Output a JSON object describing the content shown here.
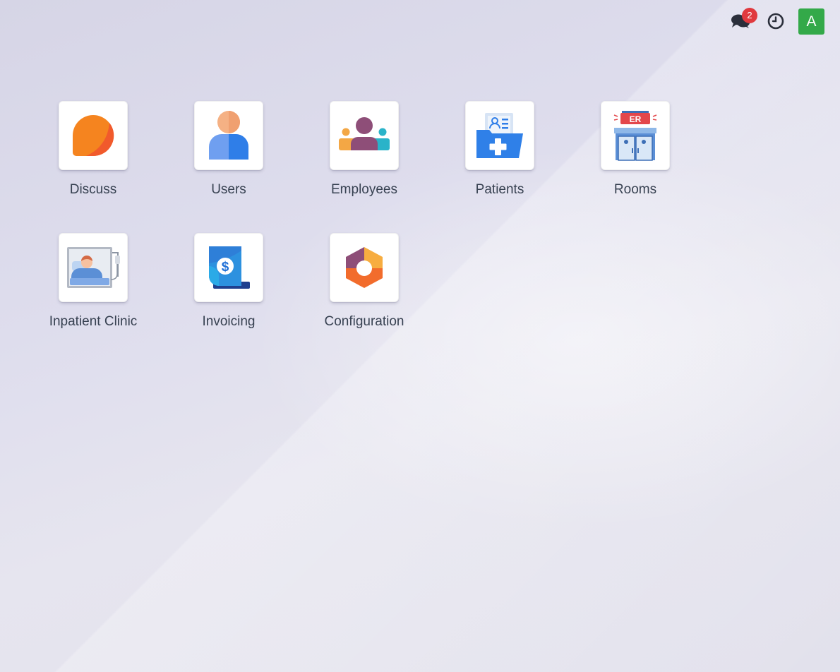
{
  "systray": {
    "messages_count": "2",
    "user_initial": "A"
  },
  "apps": [
    {
      "label": "Discuss",
      "icon": "discuss-icon"
    },
    {
      "label": "Users",
      "icon": "users-icon"
    },
    {
      "label": "Employees",
      "icon": "employees-icon"
    },
    {
      "label": "Patients",
      "icon": "patients-icon"
    },
    {
      "label": "Rooms",
      "icon": "rooms-icon"
    },
    {
      "label": "Inpatient Clinic",
      "icon": "inpatient-clinic-icon"
    },
    {
      "label": "Invoicing",
      "icon": "invoicing-icon"
    },
    {
      "label": "Configuration",
      "icon": "configuration-icon"
    }
  ],
  "colors": {
    "avatar": "#33a949",
    "badge": "#e0393e",
    "label": "#374151"
  }
}
